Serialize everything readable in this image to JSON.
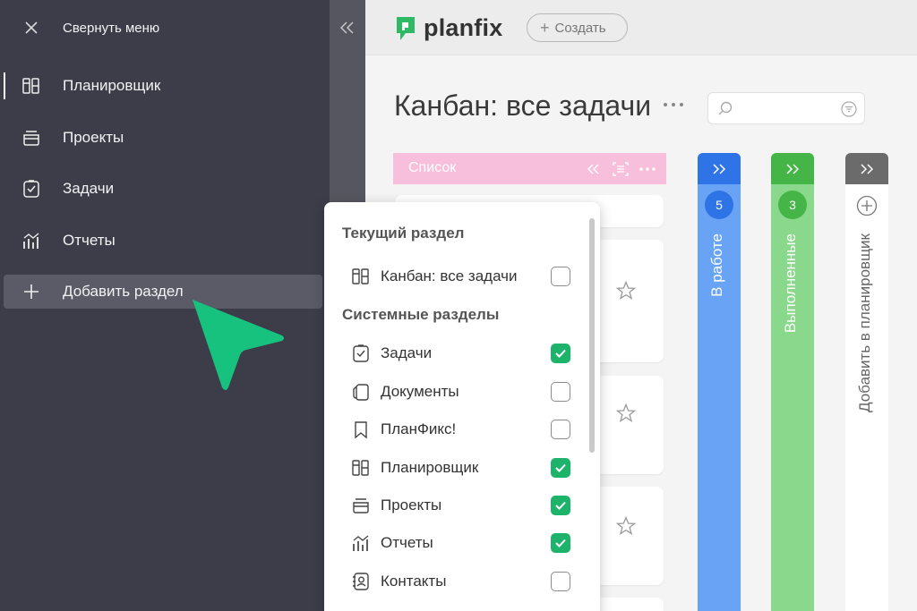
{
  "sidebar": {
    "collapse_label": "Свернуть меню",
    "items": [
      {
        "label": "Планировщик",
        "icon": "planner-icon"
      },
      {
        "label": "Проекты",
        "icon": "projects-icon"
      },
      {
        "label": "Задачи",
        "icon": "tasks-icon"
      },
      {
        "label": "Отчеты",
        "icon": "reports-icon"
      }
    ],
    "add_label": "Добавить раздел"
  },
  "header": {
    "logo_text": "planfix",
    "create_label": "Создать"
  },
  "page": {
    "title": "Канбан: все задачи"
  },
  "kanban": {
    "list_column": {
      "name": "Список",
      "color": "#f8bfdc"
    },
    "status_columns": [
      {
        "label": "В работе",
        "count": "5",
        "color": "#5b9cf5",
        "badge_color": "#2f74e6"
      },
      {
        "label": "Выполненные",
        "count": "3",
        "color": "#89d688",
        "badge_color": "#45b548"
      },
      {
        "label": "Добавить в планировщик",
        "count": "",
        "color": "#6b6b6b"
      }
    ]
  },
  "dropdown": {
    "current_header": "Текущий раздел",
    "current_items": [
      {
        "label": "Канбан: все задачи",
        "icon": "planner-icon",
        "checked": false
      }
    ],
    "system_header": "Системные разделы",
    "system_items": [
      {
        "label": "Задачи",
        "icon": "tasks-icon",
        "checked": true
      },
      {
        "label": "Документы",
        "icon": "documents-icon",
        "checked": false
      },
      {
        "label": "ПланФикс!",
        "icon": "bookmark-icon",
        "checked": false
      },
      {
        "label": "Планировщик",
        "icon": "planner-icon",
        "checked": true
      },
      {
        "label": "Проекты",
        "icon": "projects-icon",
        "checked": true
      },
      {
        "label": "Отчеты",
        "icon": "reports-icon",
        "checked": true
      },
      {
        "label": "Контакты",
        "icon": "contacts-icon",
        "checked": false
      }
    ]
  },
  "colors": {
    "sidebar_bg": "#3c3d49",
    "accent_green": "#1db36b",
    "cursor_green": "#17c27f"
  }
}
